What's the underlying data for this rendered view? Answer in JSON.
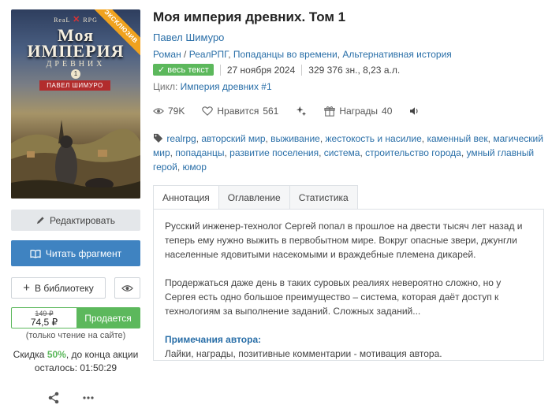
{
  "cover": {
    "publisher_left": "ReaL",
    "publisher_right": "RPG",
    "title_line1": "Моя",
    "title_line2": "ИМПЕРИЯ",
    "title_line3": "ДРЕВНИХ",
    "volume_mark": "1",
    "author_banner": "ПАВЕЛ ШИМУРО",
    "ribbon": "ЭКСКЛЮЗИВ"
  },
  "sidebar": {
    "edit_label": "Редактировать",
    "read_label": "Читать фрагмент",
    "library_label": "В библиотеку",
    "price_old": "149 ₽",
    "price_new": "74,5 ₽",
    "sale_label": "Продается",
    "price_note": "(только чтение на сайте)",
    "discount_prefix": "Скидка ",
    "discount_pct": "50%",
    "discount_suffix": ", до конца акции",
    "remaining": "осталось: 01:50:29"
  },
  "book": {
    "title": "Моя империя древних. Том 1",
    "author": "Павел Шимуро",
    "genres": [
      "Роман",
      "РеалРПГ",
      "Попаданцы во времени",
      "Альтернативная история"
    ],
    "full_text_badge": "весь текст",
    "date": "27 ноября 2024",
    "size": "329 376 зн., 8,23 а.л.",
    "cycle_label": "Цикл:",
    "cycle_name": "Империя древних #1"
  },
  "stats": {
    "views": "79K",
    "likes_label": "Нравится",
    "likes": "561",
    "awards_label": "Награды",
    "awards": "40"
  },
  "tags": [
    "realrpg",
    "авторский мир",
    "выживание",
    "жестокость и насилие",
    "каменный век",
    "магический мир",
    "попаданцы",
    "развитие поселения",
    "система",
    "строительство города",
    "умный главный герой",
    "юмор"
  ],
  "tabs": [
    "Аннотация",
    "Оглавление",
    "Статистика"
  ],
  "annotation": {
    "p1": "Русский инженер-технолог Сергей попал в прошлое на двести тысяч лет назад и теперь ему нужно выжить в первобытном мире. Вокруг опасные звери, джунгли населенные ядовитыми насекомыми и враждебные племена дикарей.",
    "p2": "Продержаться даже день в таких суровых реалиях невероятно сложно, но у Сергея есть одно большое преимущество – система, которая даёт доступ к технологиям за выполнение заданий. Сложных заданий...",
    "notes_title": "Примечания автора:",
    "notes_text": "Лайки, награды, позитивные комментарии - мотивация автора."
  }
}
